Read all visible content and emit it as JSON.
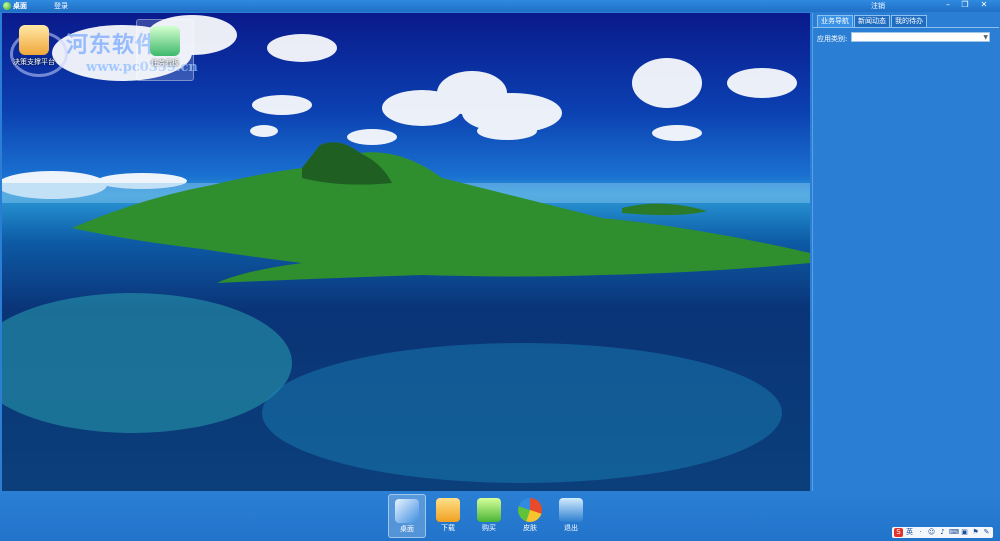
{
  "titlebar": {
    "title": "桌面",
    "menu_login": "登录",
    "logout": "注销",
    "minimize_glyph": "–",
    "maximize_glyph": "❐",
    "close_glyph": "✕"
  },
  "desktop": {
    "icons": [
      {
        "label": "决策支撑平台",
        "icon": "platform-icon"
      },
      {
        "label": "任务看板",
        "icon": "tasks-icon"
      }
    ],
    "watermark": {
      "text": "河东软件园",
      "url": "www.pc0359.cn"
    }
  },
  "panel": {
    "tabs": [
      "业务导航",
      "新闻动态",
      "我的待办"
    ],
    "active_tab": 0,
    "category_label": "应用类别:",
    "category_value": ""
  },
  "taskbar": {
    "items": [
      {
        "label": "桌面",
        "icon": "desktop-icon",
        "active": true
      },
      {
        "label": "下载",
        "icon": "download-folder-icon",
        "active": false
      },
      {
        "label": "购买",
        "icon": "soft-store-icon",
        "active": false
      },
      {
        "label": "皮肤",
        "icon": "skin-palette-icon",
        "active": false
      },
      {
        "label": "退出",
        "icon": "exit-icon",
        "active": false
      }
    ],
    "tray": [
      "S",
      "英",
      "·",
      "☺",
      "♪",
      "⌨",
      "▣",
      "⚑",
      "✎"
    ]
  },
  "colors": {
    "chrome_blue": "#2a7fd4",
    "sea_dark": "#0a3478",
    "island_green": "#2f8f2f"
  }
}
